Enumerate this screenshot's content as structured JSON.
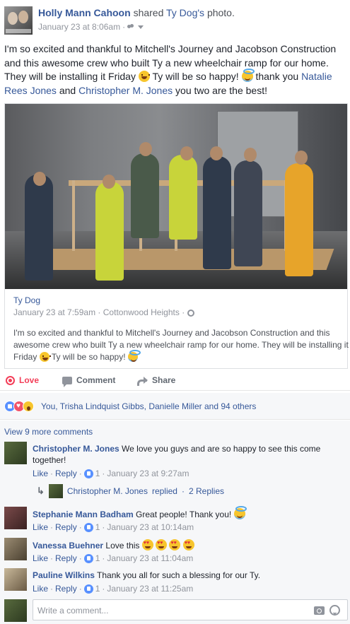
{
  "header": {
    "author": "Holly Mann Cahoon",
    "shared_word": "shared",
    "target": "Ty Dog's",
    "photo_word": "photo.",
    "timestamp": "January 23 at 8:06am",
    "separator": "·"
  },
  "post": {
    "text_1": "I'm so excited and thankful to Mitchell's Journey and Jacobson Construction and this awesome crew who built Ty a new wheelchair ramp for our home. They will be installing it Friday",
    "text_2": "Ty will be so happy!",
    "text_3": "thank you",
    "mention_1": "Natalie Rees Jones",
    "and_word": "and",
    "mention_2": "Christopher M. Jones",
    "text_4": "you two are the best!"
  },
  "shared_post": {
    "name": "Ty Dog",
    "timestamp": "January 23 at 7:59am",
    "separator": "·",
    "location": "Cottonwood Heights",
    "text_1": "I'm so excited and thankful to Mitchell's Journey and Jacobson Construction and this awesome crew who built Ty a new wheelchair ramp for our home. They will be installing it Friday",
    "text_2": "Ty will be so happy!"
  },
  "actions": {
    "love": "Love",
    "comment": "Comment",
    "share": "Share"
  },
  "reactions": {
    "summary": "You, Trisha Lindquist Gibbs, Danielle Miller and 94 others"
  },
  "comments": {
    "view_more": "View 9 more comments",
    "items": [
      {
        "name": "Christopher M. Jones",
        "text": "We love you guys and are so happy to see this come together!",
        "like": "Like",
        "reply": "Reply",
        "likes": "1",
        "time": "January 23 at 9:27am",
        "replies_author": "Christopher M. Jones",
        "replies_text": "replied",
        "replies_count": "2 Replies"
      },
      {
        "name": "Stephanie Mann Badham",
        "text": "Great people! Thank you!",
        "like": "Like",
        "reply": "Reply",
        "likes": "1",
        "time": "January 23 at 10:14am"
      },
      {
        "name": "Vanessa Buehner",
        "text": "Love this",
        "like": "Like",
        "reply": "Reply",
        "likes": "1",
        "time": "January 23 at 11:04am"
      },
      {
        "name": "Pauline Wilkins",
        "text": "Thank you all for such a blessing for our Ty.",
        "like": "Like",
        "reply": "Reply",
        "likes": "1",
        "time": "January 23 at 11:25am"
      }
    ],
    "write_placeholder": "Write a comment..."
  },
  "sep": "·",
  "colors": {
    "link": "#365899",
    "love": "#f33e58",
    "meta": "#90949c",
    "panel": "#f6f7f9"
  }
}
